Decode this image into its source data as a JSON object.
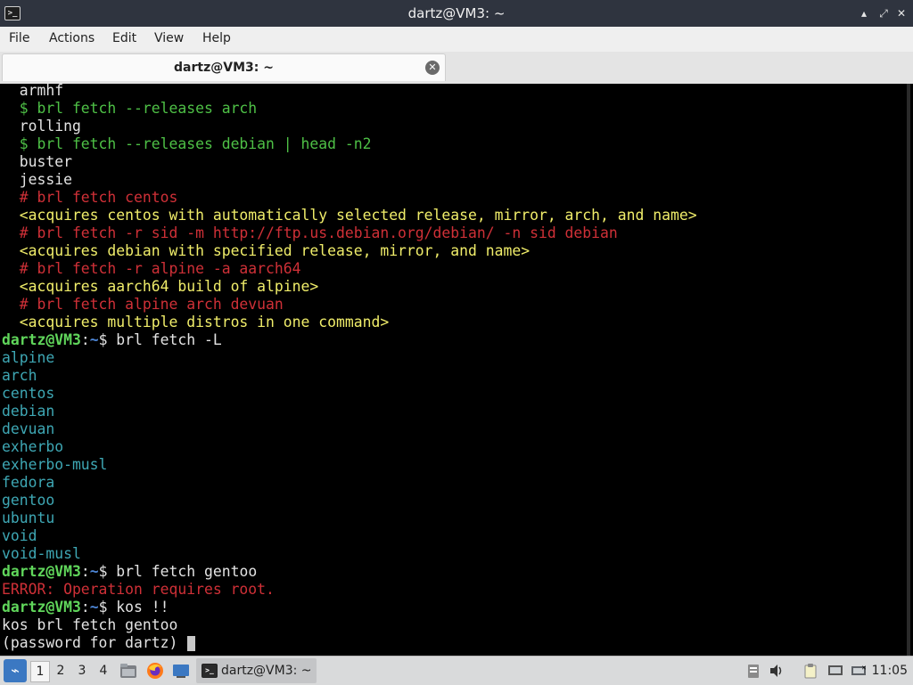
{
  "window": {
    "title": "dartz@VM3: ~",
    "minimize": "▴",
    "restore": "⤢",
    "close": "✕"
  },
  "menu": [
    "File",
    "Actions",
    "Edit",
    "View",
    "Help"
  ],
  "tab": {
    "label": "dartz@VM3: ~",
    "close": "✕"
  },
  "terminal": {
    "prompt_user": "dartz@VM3",
    "prompt_sep": ":",
    "prompt_dir": "~",
    "prompt_end": "$",
    "lines": [
      {
        "t": "  armhf",
        "c": "white"
      },
      {
        "t": "  $ brl fetch --releases arch",
        "c": "green"
      },
      {
        "t": "  rolling",
        "c": "white"
      },
      {
        "t": "  $ brl fetch --releases debian | head -n2",
        "c": "green"
      },
      {
        "t": "  buster",
        "c": "white"
      },
      {
        "t": "  jessie",
        "c": "white"
      },
      {
        "t": "  # brl fetch centos",
        "c": "red"
      },
      {
        "t": "  <acquires centos with automatically selected release, mirror, arch, and name>",
        "c": "yellow"
      },
      {
        "t": "  # brl fetch -r sid -m http://ftp.us.debian.org/debian/ -n sid debian",
        "c": "red"
      },
      {
        "t": "  <acquires debian with specified release, mirror, and name>",
        "c": "yellow"
      },
      {
        "t": "  # brl fetch -r alpine -a aarch64",
        "c": "red"
      },
      {
        "t": "  <acquires aarch64 build of alpine>",
        "c": "yellow"
      },
      {
        "t": "  # brl fetch alpine arch devuan",
        "c": "red"
      },
      {
        "t": "  <acquires multiple distros in one command>",
        "c": "yellow"
      },
      {
        "t": " brl fetch -L",
        "c": "prompt"
      },
      {
        "t": "alpine",
        "c": "cyan"
      },
      {
        "t": "arch",
        "c": "cyan"
      },
      {
        "t": "centos",
        "c": "cyan"
      },
      {
        "t": "debian",
        "c": "cyan"
      },
      {
        "t": "devuan",
        "c": "cyan"
      },
      {
        "t": "exherbo",
        "c": "cyan"
      },
      {
        "t": "exherbo-musl",
        "c": "cyan"
      },
      {
        "t": "fedora",
        "c": "cyan"
      },
      {
        "t": "gentoo",
        "c": "cyan"
      },
      {
        "t": "ubuntu",
        "c": "cyan"
      },
      {
        "t": "void",
        "c": "cyan"
      },
      {
        "t": "void-musl",
        "c": "cyan"
      },
      {
        "t": " brl fetch gentoo",
        "c": "prompt"
      },
      {
        "t": "ERROR: Operation requires root.",
        "c": "red"
      },
      {
        "t": " kos !!",
        "c": "prompt"
      },
      {
        "t": "kos brl fetch gentoo",
        "c": "white"
      },
      {
        "t": "(password for dartz) ",
        "c": "white",
        "cursor": true
      }
    ]
  },
  "taskbar": {
    "workspaces": [
      "1",
      "2",
      "3",
      "4"
    ],
    "active_workspace": "1",
    "task_label": "dartz@VM3: ~",
    "clock": "11:05"
  },
  "colors": {
    "titlebar": "#2f343f",
    "prompt_green": "#60d65b",
    "path_blue": "#4d86d6",
    "cyan_list": "#3ea7b4",
    "comment_red": "#cf3037",
    "note_yellow": "#f0ed6a",
    "cmd_green": "#4ec046"
  }
}
